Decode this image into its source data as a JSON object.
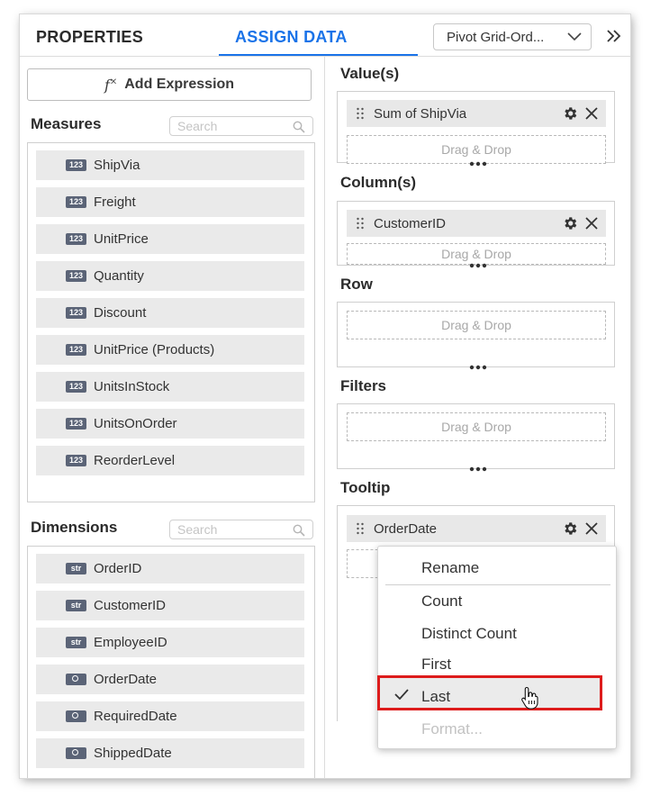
{
  "header": {
    "tab_properties": "PROPERTIES",
    "tab_assign_data": "ASSIGN DATA",
    "widget_select_value": "Pivot Grid-Ord...",
    "accent_color": "#1a73e8"
  },
  "left": {
    "add_expression_label": "Add Expression",
    "fx_glyph": "f",
    "fx_sup": "×",
    "measures": {
      "title": "Measures",
      "search_placeholder": "Search",
      "items": [
        {
          "type": "123",
          "label": "ShipVia"
        },
        {
          "type": "123",
          "label": "Freight"
        },
        {
          "type": "123",
          "label": "UnitPrice"
        },
        {
          "type": "123",
          "label": "Quantity"
        },
        {
          "type": "123",
          "label": "Discount"
        },
        {
          "type": "123",
          "label": "UnitPrice (Products)"
        },
        {
          "type": "123",
          "label": "UnitsInStock"
        },
        {
          "type": "123",
          "label": "UnitsOnOrder"
        },
        {
          "type": "123",
          "label": "ReorderLevel"
        }
      ]
    },
    "dimensions": {
      "title": "Dimensions",
      "search_placeholder": "Search",
      "items": [
        {
          "type": "str",
          "label": "OrderID"
        },
        {
          "type": "str",
          "label": "CustomerID"
        },
        {
          "type": "str",
          "label": "EmployeeID"
        },
        {
          "type": "time",
          "label": "OrderDate"
        },
        {
          "type": "time",
          "label": "RequiredDate"
        },
        {
          "type": "time",
          "label": "ShippedDate"
        }
      ]
    }
  },
  "zones": {
    "value": {
      "title": "Value(s)",
      "pill": "Sum of ShipVia",
      "drop": "Drag & Drop"
    },
    "column": {
      "title": "Column(s)",
      "pill": "CustomerID",
      "drop": "Drag & Drop"
    },
    "row": {
      "title": "Row",
      "drop": "Drag & Drop"
    },
    "filters": {
      "title": "Filters",
      "drop": "Drag & Drop"
    },
    "tooltip": {
      "title": "Tooltip",
      "pill": "OrderDate"
    }
  },
  "context_menu": {
    "items": [
      "Rename",
      "Count",
      "Distinct Count",
      "First",
      "Last",
      "Format..."
    ],
    "selected": "Last",
    "highlight_color": "#dd1c1c"
  }
}
